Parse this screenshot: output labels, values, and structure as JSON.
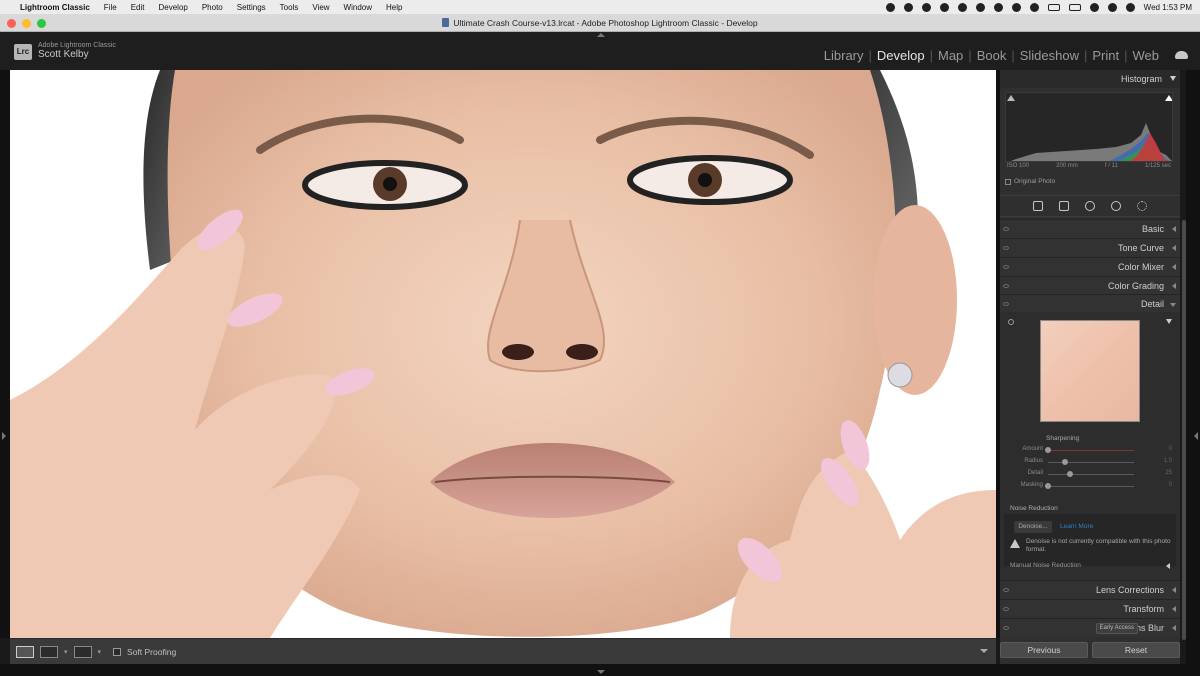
{
  "menubar": {
    "app": "Lightroom Classic",
    "items": [
      "File",
      "Edit",
      "Develop",
      "Photo",
      "Settings",
      "Tools",
      "View",
      "Window",
      "Help"
    ],
    "clock": "Wed 1:53 PM"
  },
  "window": {
    "title": "Ultimate Crash Course-v13.lrcat - Adobe Photoshop Lightroom Classic - Develop"
  },
  "identity": {
    "logo": "Lrc",
    "product": "Adobe Lightroom Classic",
    "user": "Scott Kelby"
  },
  "modules": [
    {
      "label": "Library",
      "active": false
    },
    {
      "label": "Develop",
      "active": true
    },
    {
      "label": "Map",
      "active": false
    },
    {
      "label": "Book",
      "active": false
    },
    {
      "label": "Slideshow",
      "active": false
    },
    {
      "label": "Print",
      "active": false
    },
    {
      "label": "Web",
      "active": false
    }
  ],
  "histogram": {
    "title": "Histogram",
    "iso": "ISO 100",
    "focal": "200 mm",
    "aperture": "f / 11",
    "shutter": "1/125 sec",
    "original_photo": "Original Photo"
  },
  "panels": {
    "basic": "Basic",
    "tone_curve": "Tone Curve",
    "color_mixer": "Color Mixer",
    "color_grading": "Color Grading",
    "detail": "Detail",
    "lens_corrections": "Lens Corrections",
    "transform": "Transform",
    "lens_blur": "Lens Blur",
    "early_access": "Early Access"
  },
  "detail": {
    "sharpening_title": "Sharpening",
    "sliders": [
      {
        "label": "Amount",
        "value": "0",
        "level": 0.0
      },
      {
        "label": "Radius",
        "value": "1.0",
        "level": 0.2
      },
      {
        "label": "Detail",
        "value": "25",
        "level": 0.25
      },
      {
        "label": "Masking",
        "value": "0",
        "level": 0.0
      }
    ],
    "noise_reduction_title": "Noise Reduction",
    "denoise_button": "Denoise...",
    "learn_more": "Learn More",
    "warning": "Denoise is not currently compatible with this photo format.",
    "manual_nr": "Manual Noise Reduction"
  },
  "toolbar": {
    "view_label_1": "",
    "view_label_2": "",
    "soft_proofing": "Soft Proofing"
  },
  "buttons": {
    "previous": "Previous",
    "reset": "Reset"
  }
}
